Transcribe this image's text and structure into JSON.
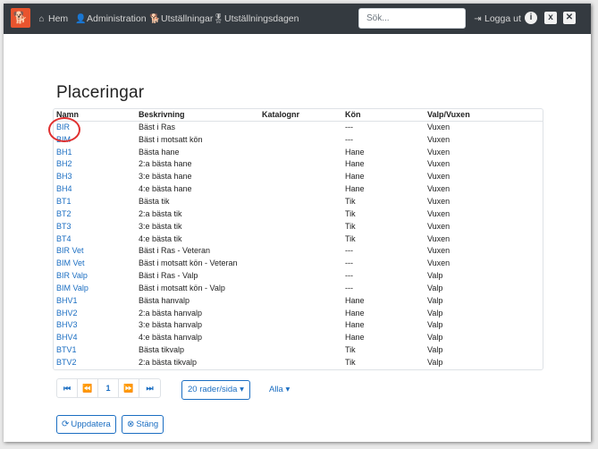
{
  "nav": {
    "home_label": "Hem",
    "admin_label": "Administration",
    "shows_label": "Utställningar",
    "showday_label": "Utställningsdagen",
    "search_placeholder": "Sök...",
    "logout_label": "Logga ut",
    "info_symbol": "i",
    "excel_symbol": "x",
    "close_symbol": "✕"
  },
  "page": {
    "title": "Placeringar"
  },
  "table": {
    "headers": [
      "Namn",
      "Beskrivning",
      "Katalognr",
      "Kön",
      "Valp/Vuxen"
    ],
    "rows": [
      [
        "BIR",
        "Bäst i Ras",
        "",
        "---",
        "Vuxen"
      ],
      [
        "BIM",
        "Bäst i motsatt kön",
        "",
        "---",
        "Vuxen"
      ],
      [
        "BH1",
        "Bästa hane",
        "",
        "Hane",
        "Vuxen"
      ],
      [
        "BH2",
        "2:a bästa hane",
        "",
        "Hane",
        "Vuxen"
      ],
      [
        "BH3",
        "3:e bästa hane",
        "",
        "Hane",
        "Vuxen"
      ],
      [
        "BH4",
        "4:e bästa hane",
        "",
        "Hane",
        "Vuxen"
      ],
      [
        "BT1",
        "Bästa tik",
        "",
        "Tik",
        "Vuxen"
      ],
      [
        "BT2",
        "2:a bästa tik",
        "",
        "Tik",
        "Vuxen"
      ],
      [
        "BT3",
        "3:e bästa tik",
        "",
        "Tik",
        "Vuxen"
      ],
      [
        "BT4",
        "4:e bästa tik",
        "",
        "Tik",
        "Vuxen"
      ],
      [
        "BIR Vet",
        "Bäst i Ras - Veteran",
        "",
        "---",
        "Vuxen"
      ],
      [
        "BIM Vet",
        "Bäst i motsatt kön - Veteran",
        "",
        "---",
        "Vuxen"
      ],
      [
        "BIR Valp",
        "Bäst i Ras - Valp",
        "",
        "---",
        "Valp"
      ],
      [
        "BIM Valp",
        "Bäst i motsatt kön - Valp",
        "",
        "---",
        "Valp"
      ],
      [
        "BHV1",
        "Bästa hanvalp",
        "",
        "Hane",
        "Valp"
      ],
      [
        "BHV2",
        "2:a bästa hanvalp",
        "",
        "Hane",
        "Valp"
      ],
      [
        "BHV3",
        "3:e bästa hanvalp",
        "",
        "Hane",
        "Valp"
      ],
      [
        "BHV4",
        "4:e bästa hanvalp",
        "",
        "Hane",
        "Valp"
      ],
      [
        "BTV1",
        "Bästa tikvalp",
        "",
        "Tik",
        "Valp"
      ],
      [
        "BTV2",
        "2:a bästa tikvalp",
        "",
        "Tik",
        "Valp"
      ]
    ]
  },
  "pagination": {
    "first_symbol": "⏮",
    "prev_symbol": "⏪",
    "current_page": "1",
    "next_symbol": "⏩",
    "last_symbol": "⏭",
    "page_size_label": "20 rader/sida ▾",
    "filter_label": "Alla ▾"
  },
  "actions": {
    "refresh_label": "Uppdatera",
    "close_label": "Stäng"
  },
  "colors": {
    "navbar": "#343a40",
    "link": "#1b6ec2",
    "highlight": "#e03030"
  }
}
